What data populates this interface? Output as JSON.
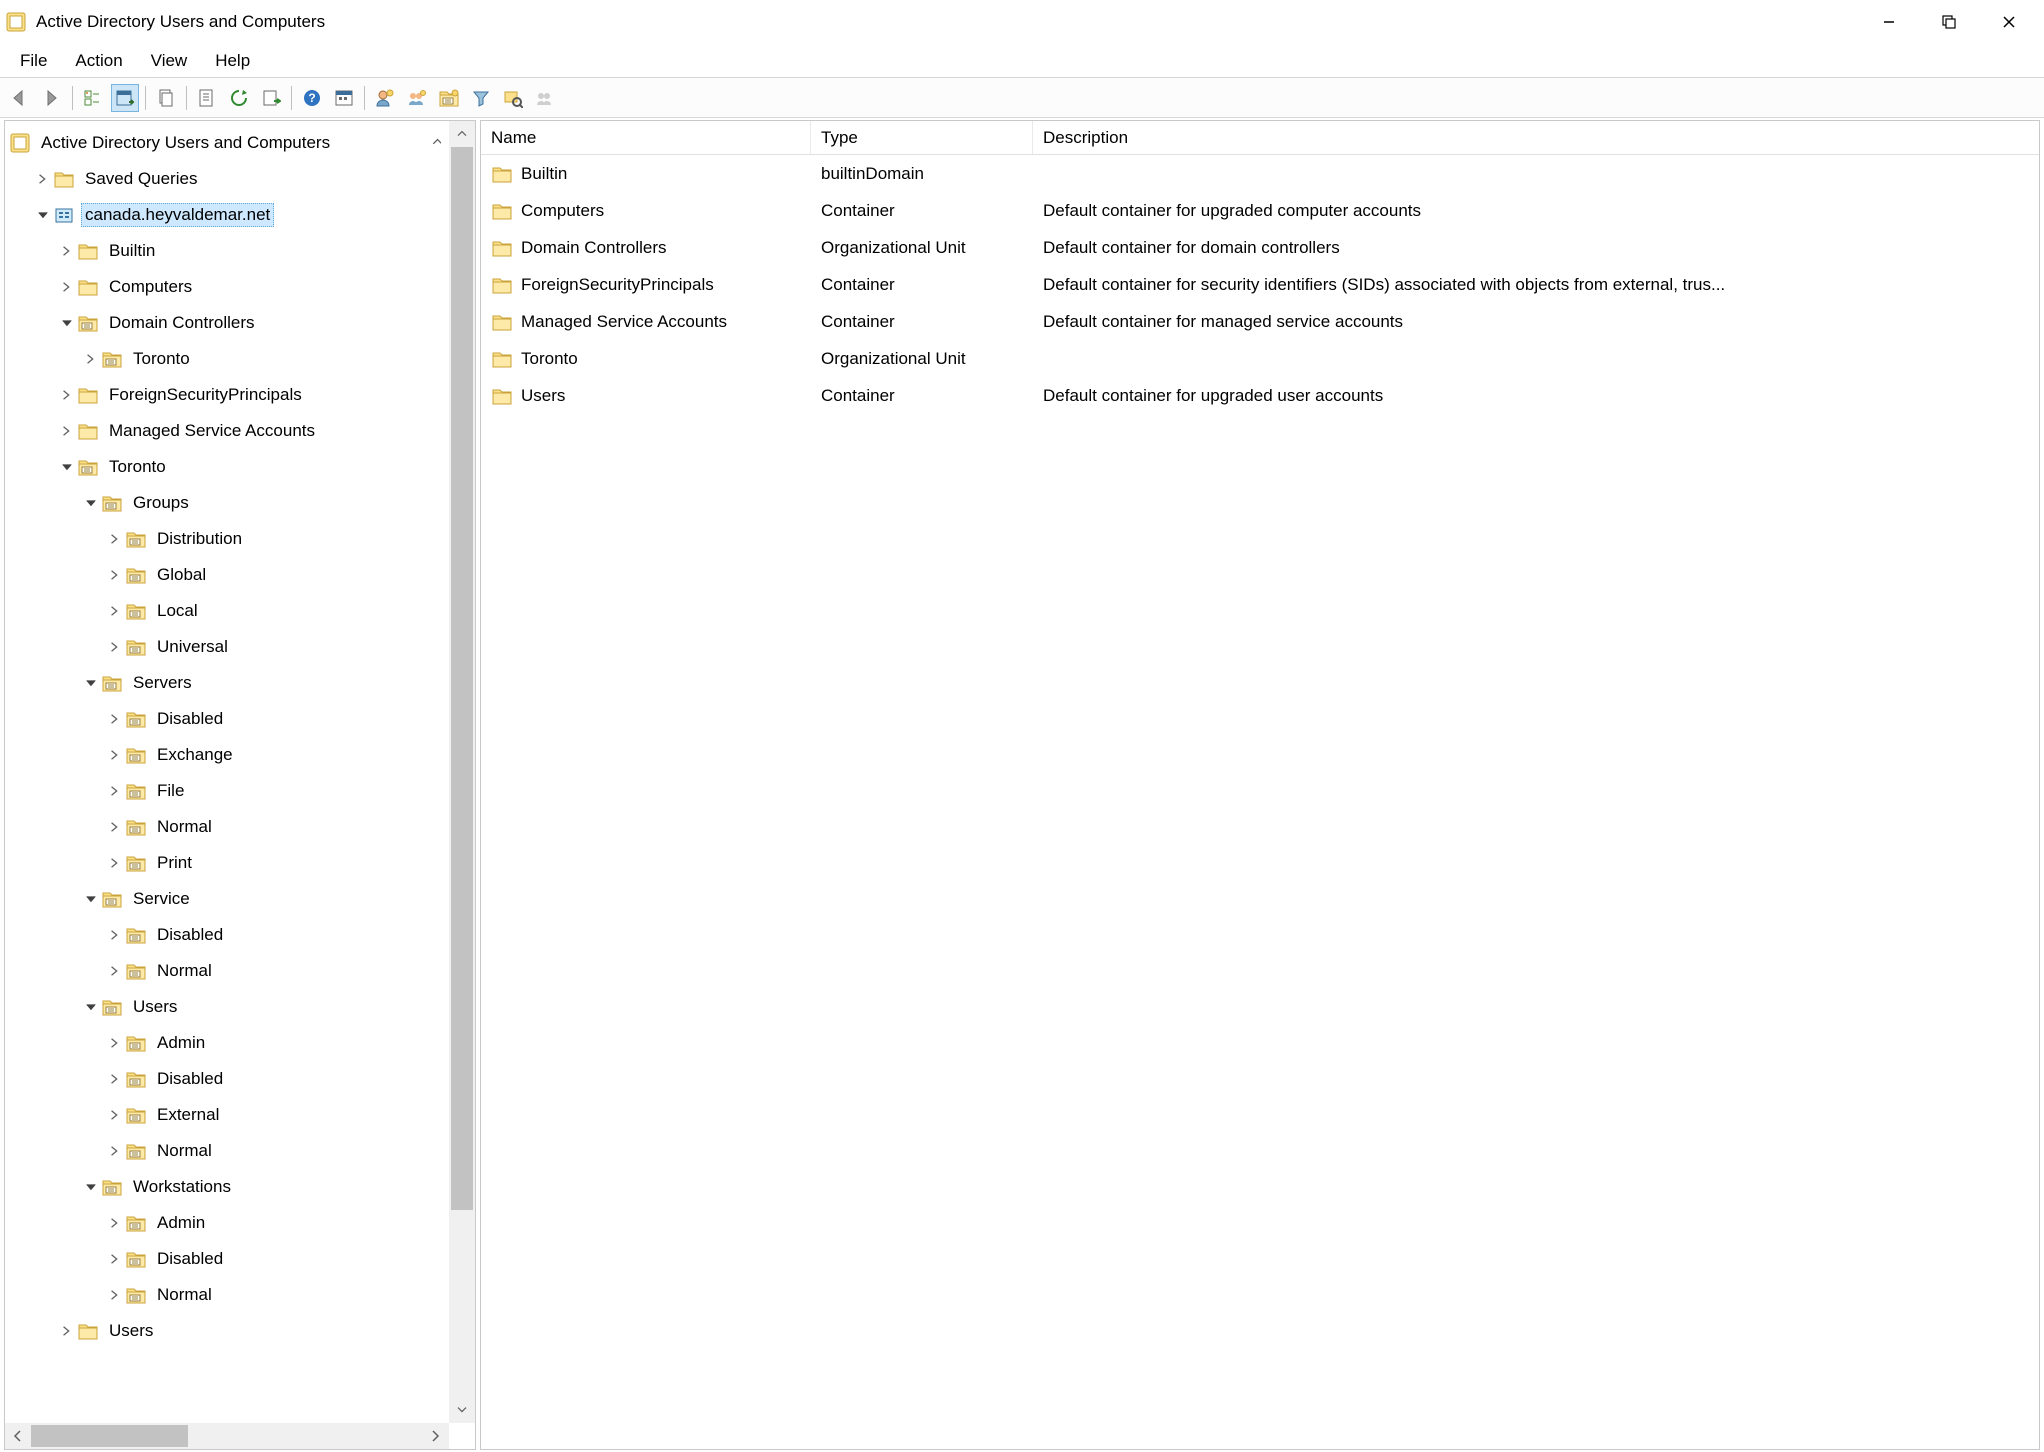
{
  "window": {
    "title": "Active Directory Users and Computers"
  },
  "menu": {
    "items": [
      "File",
      "Action",
      "View",
      "Help"
    ]
  },
  "toolbar": {
    "buttons": [
      "nav-back",
      "nav-forward",
      "|",
      "show-hide-tree",
      "properties-window",
      "|",
      "copy",
      "|",
      "properties",
      "refresh",
      "export-list",
      "|",
      "help",
      "large-icons",
      "|",
      "new-user",
      "new-group",
      "new-ou",
      "filter",
      "find",
      "add-to-group"
    ],
    "pressed": "properties-window"
  },
  "tree": {
    "root_label": "Active Directory Users and Computers",
    "nodes": [
      {
        "id": "saved-queries",
        "label": "Saved Queries",
        "depth": 1,
        "exp": "closed",
        "icon": "folder"
      },
      {
        "id": "domain",
        "label": "canada.heyvaldemar.net",
        "depth": 1,
        "exp": "open",
        "icon": "domain",
        "selected": true
      },
      {
        "id": "builtin",
        "label": "Builtin",
        "depth": 2,
        "exp": "closed",
        "icon": "folder"
      },
      {
        "id": "computers",
        "label": "Computers",
        "depth": 2,
        "exp": "closed",
        "icon": "folder"
      },
      {
        "id": "dc",
        "label": "Domain Controllers",
        "depth": 2,
        "exp": "open",
        "icon": "ou"
      },
      {
        "id": "dc-toronto",
        "label": "Toronto",
        "depth": 3,
        "exp": "closed",
        "icon": "ou"
      },
      {
        "id": "fsp",
        "label": "ForeignSecurityPrincipals",
        "depth": 2,
        "exp": "closed",
        "icon": "folder"
      },
      {
        "id": "msa",
        "label": "Managed Service Accounts",
        "depth": 2,
        "exp": "closed",
        "icon": "folder"
      },
      {
        "id": "toronto",
        "label": "Toronto",
        "depth": 2,
        "exp": "open",
        "icon": "ou"
      },
      {
        "id": "groups",
        "label": "Groups",
        "depth": 3,
        "exp": "open",
        "icon": "ou"
      },
      {
        "id": "g-dist",
        "label": "Distribution",
        "depth": 4,
        "exp": "closed",
        "icon": "ou"
      },
      {
        "id": "g-global",
        "label": "Global",
        "depth": 4,
        "exp": "closed",
        "icon": "ou"
      },
      {
        "id": "g-local",
        "label": "Local",
        "depth": 4,
        "exp": "closed",
        "icon": "ou"
      },
      {
        "id": "g-univ",
        "label": "Universal",
        "depth": 4,
        "exp": "closed",
        "icon": "ou"
      },
      {
        "id": "servers",
        "label": "Servers",
        "depth": 3,
        "exp": "open",
        "icon": "ou"
      },
      {
        "id": "s-dis",
        "label": "Disabled",
        "depth": 4,
        "exp": "closed",
        "icon": "ou"
      },
      {
        "id": "s-exch",
        "label": "Exchange",
        "depth": 4,
        "exp": "closed",
        "icon": "ou"
      },
      {
        "id": "s-file",
        "label": "File",
        "depth": 4,
        "exp": "closed",
        "icon": "ou"
      },
      {
        "id": "s-norm",
        "label": "Normal",
        "depth": 4,
        "exp": "closed",
        "icon": "ou"
      },
      {
        "id": "s-print",
        "label": "Print",
        "depth": 4,
        "exp": "closed",
        "icon": "ou"
      },
      {
        "id": "service",
        "label": "Service",
        "depth": 3,
        "exp": "open",
        "icon": "ou"
      },
      {
        "id": "svc-dis",
        "label": "Disabled",
        "depth": 4,
        "exp": "closed",
        "icon": "ou"
      },
      {
        "id": "svc-norm",
        "label": "Normal",
        "depth": 4,
        "exp": "closed",
        "icon": "ou"
      },
      {
        "id": "users-ou",
        "label": "Users",
        "depth": 3,
        "exp": "open",
        "icon": "ou"
      },
      {
        "id": "u-admin",
        "label": "Admin",
        "depth": 4,
        "exp": "closed",
        "icon": "ou"
      },
      {
        "id": "u-dis",
        "label": "Disabled",
        "depth": 4,
        "exp": "closed",
        "icon": "ou"
      },
      {
        "id": "u-ext",
        "label": "External",
        "depth": 4,
        "exp": "closed",
        "icon": "ou"
      },
      {
        "id": "u-norm",
        "label": "Normal",
        "depth": 4,
        "exp": "closed",
        "icon": "ou"
      },
      {
        "id": "wkst",
        "label": "Workstations",
        "depth": 3,
        "exp": "open",
        "icon": "ou"
      },
      {
        "id": "w-admin",
        "label": "Admin",
        "depth": 4,
        "exp": "closed",
        "icon": "ou"
      },
      {
        "id": "w-dis",
        "label": "Disabled",
        "depth": 4,
        "exp": "closed",
        "icon": "ou"
      },
      {
        "id": "w-norm",
        "label": "Normal",
        "depth": 4,
        "exp": "closed",
        "icon": "ou"
      },
      {
        "id": "users-cn",
        "label": "Users",
        "depth": 2,
        "exp": "closed",
        "icon": "folder"
      }
    ]
  },
  "list": {
    "columns": {
      "name": "Name",
      "type": "Type",
      "desc": "Description"
    },
    "rows": [
      {
        "name": "Builtin",
        "type": "builtinDomain",
        "desc": ""
      },
      {
        "name": "Computers",
        "type": "Container",
        "desc": "Default container for upgraded computer accounts"
      },
      {
        "name": "Domain Controllers",
        "type": "Organizational Unit",
        "desc": "Default container for domain controllers"
      },
      {
        "name": "ForeignSecurityPrincipals",
        "type": "Container",
        "desc": "Default container for security identifiers (SIDs) associated with objects from external, trus..."
      },
      {
        "name": "Managed Service Accounts",
        "type": "Container",
        "desc": "Default container for managed service accounts"
      },
      {
        "name": "Toronto",
        "type": "Organizational Unit",
        "desc": ""
      },
      {
        "name": "Users",
        "type": "Container",
        "desc": "Default container for upgraded user accounts"
      }
    ]
  }
}
